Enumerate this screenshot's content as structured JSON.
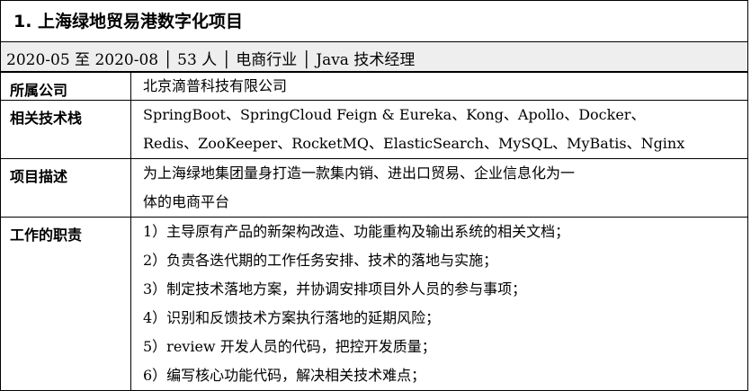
{
  "project": {
    "title": "1. 上海绿地贸易港数字化项目",
    "meta": "2020-05 至 2020-08 │ 53 人 │ 电商行业 │ Java 技术经理",
    "rows": [
      {
        "label": "所属公司",
        "lines": [
          "北京滴普科技有限公司"
        ]
      },
      {
        "label": "相关技术栈",
        "lines": [
          "SpringBoot、SpringCloud Feign & Eureka、Kong、Apollo、Docker、",
          "Redis、ZooKeeper、RocketMQ、ElasticSearch、MySQL、MyBatis、Nginx"
        ]
      },
      {
        "label": "项目描述",
        "lines": [
          "为上海绿地集团量身打造一款集内销、进出口贸易、企业信息化为一",
          "体的电商平台"
        ]
      },
      {
        "label": "工作的职责",
        "lines": [
          "1）主导原有产品的新架构改造、功能重构及输出系统的相关文档；",
          "2）负责各迭代期的工作任务安排、技术的落地与实施；",
          "3）制定技术落地方案，并协调安排项目外人员的参与事项；",
          "4）识别和反馈技术方案执行落地的延期风险；",
          "5）review 开发人员的代码，把控开发质量；",
          "6）编写核心功能代码，解决相关技术难点；"
        ]
      }
    ]
  }
}
